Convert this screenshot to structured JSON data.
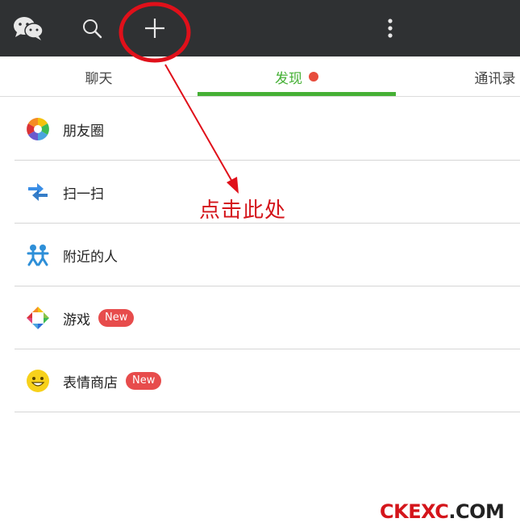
{
  "topbar": {
    "icons": [
      "wechat-logo-icon",
      "search-icon",
      "plus-icon",
      "more-vertical-icon"
    ]
  },
  "tabs": [
    {
      "label": "聊天"
    },
    {
      "label": "发现",
      "active": true,
      "has_dot": true
    },
    {
      "label": "通讯录"
    }
  ],
  "list": [
    {
      "label": "朋友圈",
      "icon": "moments-icon"
    },
    {
      "label": "扫一扫",
      "icon": "scan-icon"
    },
    {
      "label": "附近的人",
      "icon": "people-nearby-icon"
    },
    {
      "label": "游戏",
      "icon": "games-icon",
      "badge": "New"
    },
    {
      "label": "表情商店",
      "icon": "sticker-shop-icon",
      "badge": "New"
    }
  ],
  "annotation": {
    "text": "点击此处"
  },
  "watermark": {
    "red": "CKEXC",
    "dark": ".COM"
  },
  "colors": {
    "topbar": "#2f3133",
    "accent_green": "#45b035",
    "badge_red": "#e74c4c",
    "annotation_red": "#d4151b"
  }
}
